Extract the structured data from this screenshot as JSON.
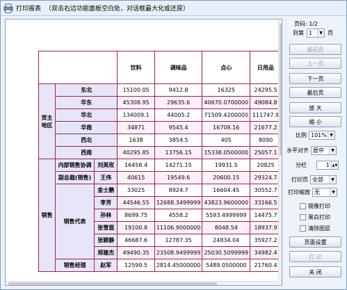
{
  "window": {
    "title": "打印报表",
    "hint": "（双击右边功能面板空白处，对话框最大化或还原）"
  },
  "report": {
    "headers": [
      "饮料",
      "调味品",
      "点心",
      "日用品"
    ],
    "groups": {
      "region": "货主地区",
      "sales": "销售",
      "rep": "销售代表"
    },
    "rows": {
      "r1": {
        "label": "东北",
        "values": [
          "15100.05",
          "9412.8",
          "16325",
          "24295.5"
        ]
      },
      "r2": {
        "label": "华东",
        "values": [
          "45308.95",
          "29635.6",
          "40670.0700000",
          "49084.8"
        ]
      },
      "r3": {
        "label": "华北",
        "values": [
          "134009.1",
          "44005.2",
          "71509.4200000",
          "111747.9"
        ]
      },
      "r4": {
        "label": "华南",
        "values": [
          "34871",
          "9545.4",
          "16708.16",
          "21677.2"
        ]
      },
      "r5": {
        "label": "西北",
        "values": [
          "1638",
          "3854.5",
          "405",
          "8090"
        ]
      },
      "r6": {
        "label": "西南",
        "values": [
          "40295.85",
          "13756.15",
          "15338.0500000",
          "25057.1"
        ]
      },
      "r7": {
        "title": "内部销售协调",
        "label": "刘英玫",
        "values": [
          "16458.4",
          "14271.15",
          "19931.5",
          "20825"
        ]
      },
      "r8": {
        "title": "副总裁(销售)",
        "label": "王伟",
        "values": [
          "40615",
          "19549.6",
          "20600.15",
          "29324.7"
        ]
      },
      "r9": {
        "label": "金士鹏",
        "values": [
          "33025",
          "8924.7",
          "16604.45",
          "30552.7"
        ]
      },
      "r10": {
        "label": "李芳",
        "values": [
          "44546.55",
          "12688.3499999",
          "43823.9600000",
          "33166.5"
        ]
      },
      "r11": {
        "label": "孙林",
        "values": [
          "8699.75",
          "4558.2",
          "5593.4999999",
          "14475.7"
        ]
      },
      "r12": {
        "label": "张雪眉",
        "values": [
          "19100.8",
          "11106.9000000",
          "8048.54",
          "18937.9"
        ]
      },
      "r13": {
        "label": "张颖静",
        "values": [
          "46687.6",
          "12787.35",
          "24834.04",
          "35927.2"
        ]
      },
      "r14": {
        "label": "郑建杰",
        "values": [
          "49490.35",
          "23508.9499999",
          "25030.5099999",
          "34982.4"
        ]
      },
      "r15": {
        "title": "销售经理",
        "label": "赵军",
        "values": [
          "12599.5",
          "2814.45000000",
          "5489.0500000",
          "21760.4"
        ]
      }
    }
  },
  "panel": {
    "page_label": "页码: 1/2",
    "goto_prefix": "到第",
    "goto_value": "1",
    "goto_suffix": "页",
    "first_page": "最前页",
    "prev_page": "上一页",
    "next_page": "下一页",
    "last_page": "最后页",
    "zoom_in": "放 大",
    "zoom_out": "缩 小",
    "scale_label": "比例",
    "scale_value": "101%",
    "halign_label": "水平对齐",
    "halign_value": "居中",
    "columns_label": "分栏",
    "columns_value": "1",
    "print_pages_label": "打印页",
    "print_pages_value": "全部",
    "print_scale_label": "打印缩放",
    "print_scale_value": "无",
    "mirror_print": "镜像打印",
    "bw_print": "黑白打印",
    "clear_layer": "清除图层",
    "page_setup": "页面设置",
    "print": "打 印",
    "close": "关 闭"
  }
}
